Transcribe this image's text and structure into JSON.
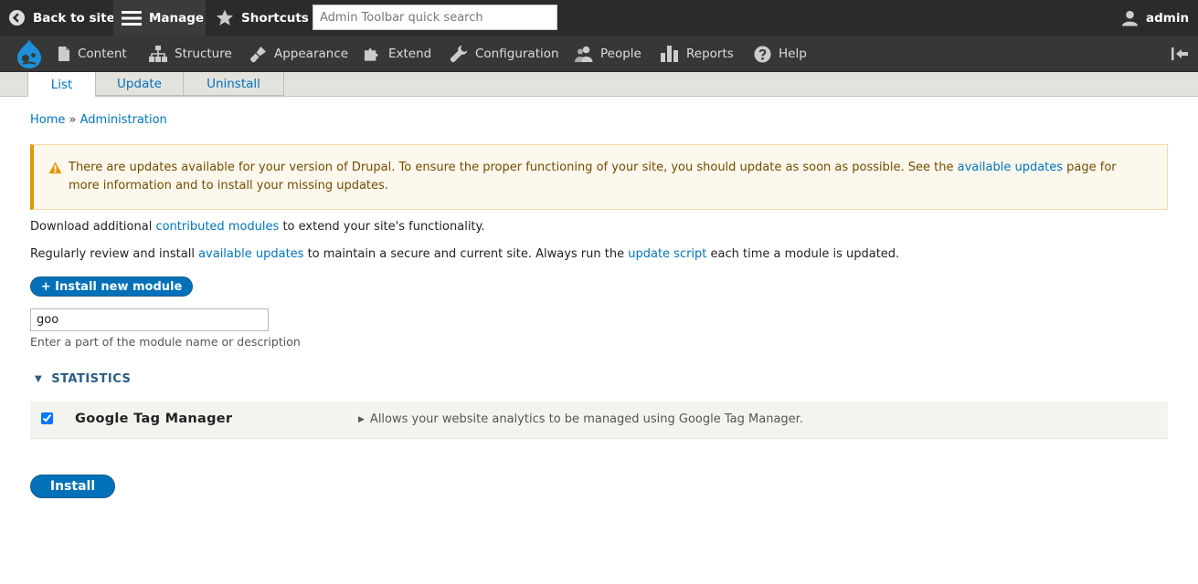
{
  "toolbar": {
    "back_label": "Back to site",
    "manage_label": "Manage",
    "shortcuts_label": "Shortcuts",
    "search_placeholder": "Admin Toolbar quick search",
    "user_label": "admin"
  },
  "menu": {
    "items": [
      {
        "label": "Content",
        "icon": "document-icon"
      },
      {
        "label": "Structure",
        "icon": "sitemap-icon"
      },
      {
        "label": "Appearance",
        "icon": "paintbrush-icon"
      },
      {
        "label": "Extend",
        "icon": "puzzle-icon"
      },
      {
        "label": "Configuration",
        "icon": "wrench-icon"
      },
      {
        "label": "People",
        "icon": "people-icon"
      },
      {
        "label": "Reports",
        "icon": "bar-chart-icon"
      },
      {
        "label": "Help",
        "icon": "help-icon"
      }
    ]
  },
  "tabs": [
    {
      "label": "List"
    },
    {
      "label": "Update"
    },
    {
      "label": "Uninstall"
    }
  ],
  "breadcrumb": {
    "home": "Home",
    "separator": "»",
    "admin": "Administration"
  },
  "warning": {
    "text_before": "There are updates available for your version of Drupal. To ensure the proper functioning of your site, you should update as soon as possible. See the ",
    "link": "available updates",
    "text_after": " page for more information and to install your missing updates."
  },
  "intro": {
    "line1_before": "Download additional ",
    "line1_link": "contributed modules",
    "line1_after": " to extend your site's functionality.",
    "line2_before": "Regularly review and install ",
    "line2_link1": "available updates",
    "line2_mid": " to maintain a secure and current site. Always run the ",
    "line2_link2": "update script",
    "line2_after": " each time a module is updated."
  },
  "install_new_label": "+ Install new module",
  "filter": {
    "value": "goo",
    "description": "Enter a part of the module name or description"
  },
  "package": {
    "name": "STATISTICS",
    "modules": [
      {
        "name": "Google Tag Manager",
        "description": "Allows your website analytics to be managed using Google Tag Manager.",
        "checked": true
      }
    ]
  },
  "install_label": "Install",
  "colors": {
    "accent": "#0071b8",
    "toolbar": "#2b2b2b",
    "warning_border": "#e09600"
  }
}
